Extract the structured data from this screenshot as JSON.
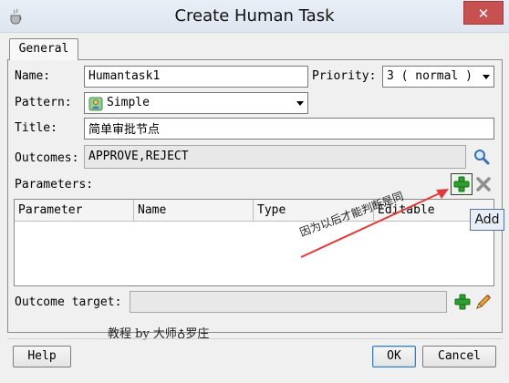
{
  "window": {
    "title": "Create Human Task",
    "close_glyph": "✕"
  },
  "tabs": [
    {
      "label": "General"
    }
  ],
  "form": {
    "name_label": "Name:",
    "name_value": "Humantask1",
    "priority_label": "Priority:",
    "priority_value": "3 ( normal )",
    "pattern_label": "Pattern:",
    "pattern_value": "Simple",
    "title_label": "Title:",
    "title_value": "简单审批节点",
    "outcomes_label": "Outcomes:",
    "outcomes_value": "APPROVE,REJECT",
    "parameters_label": "Parameters:",
    "outcome_target_label": "Outcome target:",
    "outcome_target_value": ""
  },
  "parameters_table": {
    "columns": [
      "Parameter",
      "Name",
      "Type",
      "Editable"
    ],
    "rows": []
  },
  "tooltip": "Add",
  "annotation": "因为以后才能判断是同",
  "watermark": "教程 by 大师♁罗庄",
  "buttons": {
    "help": "Help",
    "ok": "OK",
    "cancel": "Cancel"
  },
  "icons": {
    "app": "java-cup-icon",
    "search": "magnifier-icon",
    "add": "green-plus-icon",
    "remove": "gray-x-icon",
    "edit": "pencil-icon",
    "pattern": "person-icon"
  },
  "colors": {
    "accent_green": "#2e9e2e",
    "annotation_arrow": "#e23a3a",
    "close": "#c75050"
  }
}
